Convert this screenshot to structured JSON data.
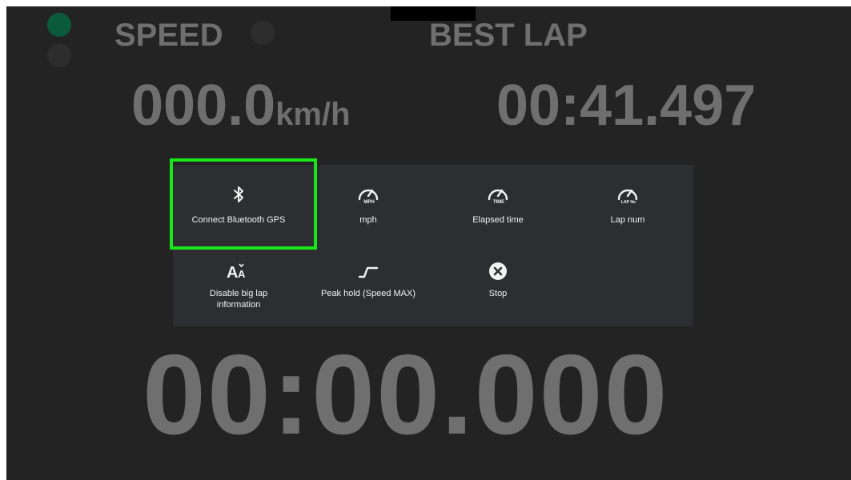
{
  "dashboard": {
    "speed_label": "SPEED",
    "best_lap_label": "BEST LAP",
    "speed_value": "000.0",
    "speed_unit": "km/h",
    "best_lap_value": "00:41.497",
    "current_timer": "00:00.000"
  },
  "menu": {
    "items": [
      {
        "label": "Connect Bluetooth GPS",
        "icon": "bluetooth-icon",
        "focused": true
      },
      {
        "label": "mph",
        "icon": "speedometer-mph-icon"
      },
      {
        "label": "Elapsed time",
        "icon": "speedometer-time-icon"
      },
      {
        "label": "Lap num",
        "icon": "speedometer-lap-icon"
      },
      {
        "label": "Disable big lap information",
        "icon": "text-size-icon"
      },
      {
        "label": "Peak hold (Speed MAX)",
        "icon": "peak-hold-icon"
      },
      {
        "label": "Stop",
        "icon": "close-circle-icon"
      }
    ],
    "gauge_icon_text": {
      "mph": "MPH",
      "time": "TIME",
      "lap": "LAP No"
    }
  },
  "colors": {
    "background": "#232323",
    "menu_bg": "#2c2e32",
    "value_gray": "#6f6f6f",
    "focus_green": "#19e619",
    "status_green": "#0b5a3c"
  }
}
